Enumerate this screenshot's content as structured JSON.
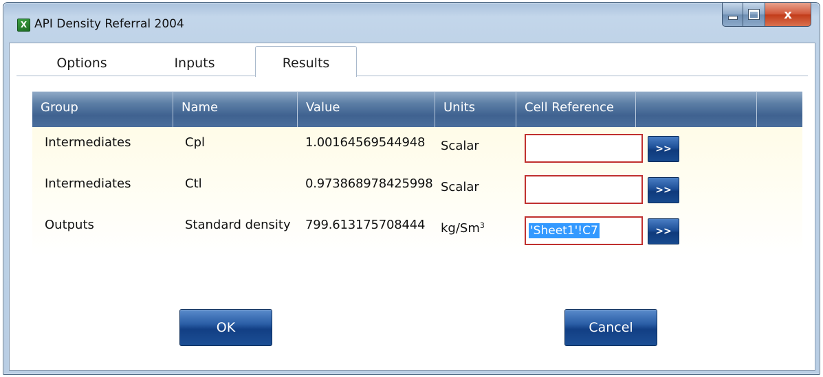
{
  "window": {
    "title": "API Density Referral 2004",
    "app_icon_glyph": "X",
    "close_glyph": "x"
  },
  "tabs": [
    {
      "label": "Options",
      "selected": false
    },
    {
      "label": "Inputs",
      "selected": false
    },
    {
      "label": "Results",
      "selected": true
    }
  ],
  "grid": {
    "columns": [
      "Group",
      "Name",
      "Value",
      "Units",
      "Cell Reference",
      ""
    ],
    "rows": [
      {
        "group": "Intermediates",
        "name": "Cpl",
        "value": "1.00164569544948",
        "units": "Scalar",
        "cell_reference": "",
        "pick_label": ">>"
      },
      {
        "group": "Intermediates",
        "name": "Ctl",
        "value": "0.973868978425998",
        "units": "Scalar",
        "cell_reference": "",
        "pick_label": ">>"
      },
      {
        "group": "Outputs",
        "name": "Standard density",
        "value": "799.613175708444",
        "units": "kg/Sm",
        "units_superscript": "3",
        "cell_reference": "'Sheet1'!C7",
        "pick_label": ">>"
      }
    ]
  },
  "buttons": {
    "ok_label": "OK",
    "cancel_label": "Cancel"
  },
  "colors": {
    "header_blue": "#3f6290",
    "button_blue": "#123f84",
    "input_border_red": "#c0302e",
    "selection_blue": "#3399ff"
  }
}
